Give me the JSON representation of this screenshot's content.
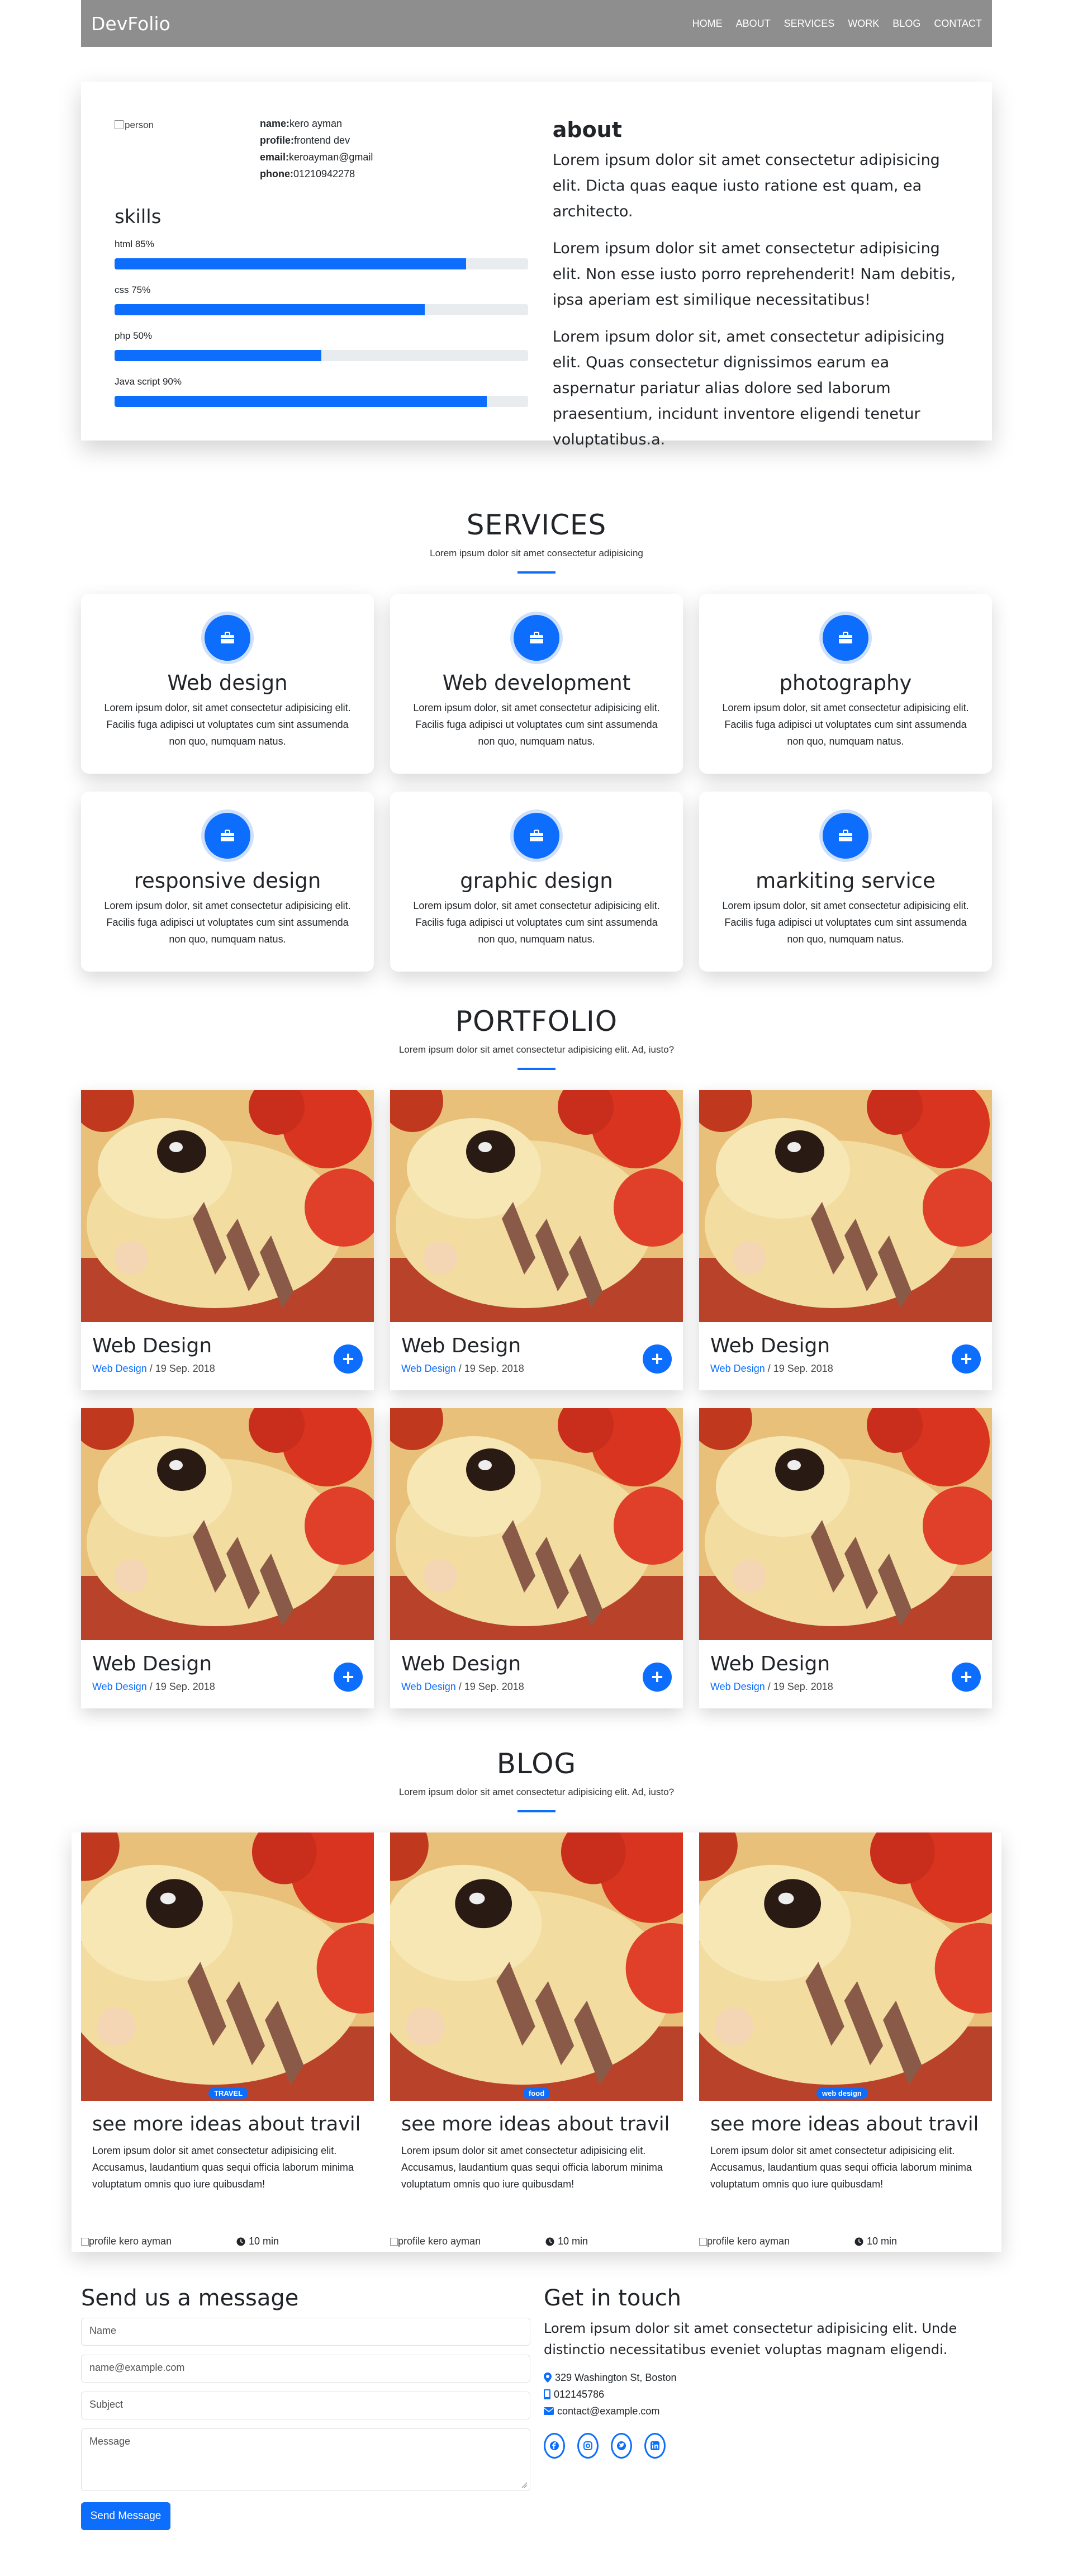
{
  "nav": {
    "brand": "DevFolio",
    "links": [
      "HOME",
      "ABOUT",
      "SERVICES",
      "WORK",
      "BLOG",
      "CONTACT"
    ]
  },
  "about": {
    "person_alt": "person",
    "name_label": "name:",
    "name_value": "kero ayman",
    "profile_label": "profile:",
    "profile_value": "frontend dev",
    "email_label": "email:",
    "email_value": "keroayman@gmail",
    "phone_label": "phone:",
    "phone_value": "01210942278",
    "skills_title": "skills",
    "skills": [
      {
        "label": "html 85%",
        "percent": 85
      },
      {
        "label": "css 75%",
        "percent": 75
      },
      {
        "label": "php 50%",
        "percent": 50
      },
      {
        "label": "Java script 90%",
        "percent": 90
      }
    ],
    "title": "about",
    "paragraphs": [
      "Lorem ipsum dolor sit amet consectetur adipisicing elit. Dicta quas eaque iusto ratione est quam, ea architecto.",
      "Lorem ipsum dolor sit amet consectetur adipisicing elit. Non esse iusto porro reprehenderit! Nam debitis, ipsa aperiam est similique necessitatibus!",
      "Lorem ipsum dolor sit, amet consectetur adipisicing elit. Quas consectetur dignissimos earum ea aspernatur pariatur alias dolore sed laborum praesentium, incidunt inventore eligendi tenetur voluptatibus.a."
    ]
  },
  "services": {
    "title": "SERVICES",
    "subtitle": "Lorem ipsum dolor sit amet consectetur adipisicing",
    "icon": "briefcase-icon",
    "items": [
      {
        "title": "Web design",
        "text": "Lorem ipsum dolor, sit amet consectetur adipisicing elit. Facilis fuga adipisci ut voluptates cum sint assumenda non quo, numquam natus."
      },
      {
        "title": "Web development",
        "text": "Lorem ipsum dolor, sit amet consectetur adipisicing elit. Facilis fuga adipisci ut voluptates cum sint assumenda non quo, numquam natus."
      },
      {
        "title": "photography",
        "text": "Lorem ipsum dolor, sit amet consectetur adipisicing elit. Facilis fuga adipisci ut voluptates cum sint assumenda non quo, numquam natus."
      },
      {
        "title": "responsive design",
        "text": "Lorem ipsum dolor, sit amet consectetur adipisicing elit. Facilis fuga adipisci ut voluptates cum sint assumenda non quo, numquam natus."
      },
      {
        "title": "graphic design",
        "text": "Lorem ipsum dolor, sit amet consectetur adipisicing elit. Facilis fuga adipisci ut voluptates cum sint assumenda non quo, numquam natus."
      },
      {
        "title": "markiting service",
        "text": "Lorem ipsum dolor, sit amet consectetur adipisicing elit. Facilis fuga adipisci ut voluptates cum sint assumenda non quo, numquam natus."
      }
    ]
  },
  "portfolio": {
    "title": "PORTFOLIO",
    "subtitle": "Lorem ipsum dolor sit amet consectetur adipisicing elit. Ad, iusto?",
    "items": [
      {
        "title": "Web Design",
        "category": "Web Design",
        "date": " / 19 Sep. 2018"
      },
      {
        "title": "Web Design",
        "category": "Web Design",
        "date": " / 19 Sep. 2018"
      },
      {
        "title": "Web Design",
        "category": "Web Design",
        "date": " / 19 Sep. 2018"
      },
      {
        "title": "Web Design",
        "category": "Web Design",
        "date": " / 19 Sep. 2018"
      },
      {
        "title": "Web Design",
        "category": "Web Design",
        "date": " / 19 Sep. 2018"
      },
      {
        "title": "Web Design",
        "category": "Web Design",
        "date": " / 19 Sep. 2018"
      }
    ],
    "plus_label": "+"
  },
  "blog": {
    "title": "BLOG",
    "subtitle": "Lorem ipsum dolor sit amet consectetur adipisicing elit. Ad, iusto?",
    "posts": [
      {
        "badge": "TRAVEL",
        "title": "see more ideas about travil",
        "text": "Lorem ipsum dolor sit amet consectetur adipisicing elit. Accusamus, laudantium quas sequi officia laborum minima voluptatum omnis quo iure quibusdam!",
        "author_alt": "profile",
        "author": " kero ayman",
        "time": "10 min"
      },
      {
        "badge": "food",
        "title": "see more ideas about travil",
        "text": "Lorem ipsum dolor sit amet consectetur adipisicing elit. Accusamus, laudantium quas sequi officia laborum minima voluptatum omnis quo iure quibusdam!",
        "author_alt": "profile",
        "author": " kero ayman",
        "time": "10 min"
      },
      {
        "badge": "web design",
        "title": "see more ideas about travil",
        "text": "Lorem ipsum dolor sit amet consectetur adipisicing elit. Accusamus, laudantium quas sequi officia laborum minima voluptatum omnis quo iure quibusdam!",
        "author_alt": "profile",
        "author": " kero ayman",
        "time": "10 min"
      }
    ]
  },
  "contact": {
    "title": "Send us a message",
    "name_placeholder": "Name",
    "email_placeholder": "name@example.com",
    "subject_placeholder": "Subject",
    "message_placeholder": "Message",
    "send_label": "Send Message",
    "touch_title": "Get in touch",
    "touch_text": "Lorem ipsum dolor sit amet consectetur adipisicing elit. Unde distinctio necessitatibus eveniet voluptas magnam eligendi.",
    "address": "329 Washington St, Boston",
    "phone": "012145786",
    "email": "contact@example.com",
    "socials": [
      "facebook-icon",
      "instagram-icon",
      "twitter-icon",
      "linkedin-icon"
    ]
  },
  "colors": {
    "accent": "#0d6efd",
    "navbar": "#8e8e8e"
  }
}
